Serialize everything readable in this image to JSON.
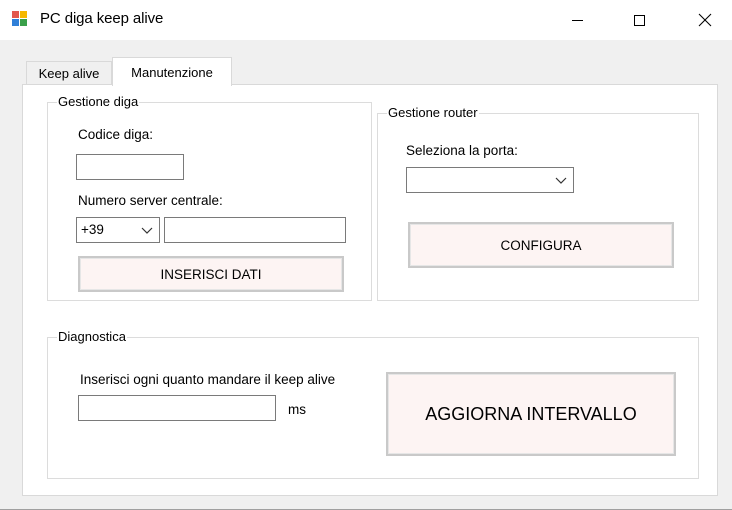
{
  "window": {
    "title": "PC diga keep alive",
    "icon": "app-window-icon",
    "controls": {
      "minimize": "minimize-icon",
      "maximize": "maximize-icon",
      "close": "close-icon"
    }
  },
  "tabs": [
    {
      "label": "Keep alive",
      "active": false
    },
    {
      "label": "Manutenzione",
      "active": true
    }
  ],
  "gestione_diga": {
    "title": "Gestione diga",
    "codice_label": "Codice diga:",
    "codice_value": "",
    "numero_label": "Numero server centrale:",
    "prefix_value": "+39",
    "numero_value": "",
    "inserisci_button": "INSERISCI DATI"
  },
  "gestione_router": {
    "title": "Gestione router",
    "porta_label": "Seleziona la porta:",
    "porta_value": "",
    "configura_button": "CONFIGURA"
  },
  "diagnostica": {
    "title": "Diagnostica",
    "intervallo_label": "Inserisci ogni quanto mandare il keep alive",
    "intervallo_value": "",
    "unit": "ms",
    "aggiorna_button": "AGGIORNA INTERVALLO"
  },
  "colors": {
    "button_bg": "#fdf4f3",
    "border": "#dcdcdc",
    "titlebar": "#ffffff",
    "window_bg": "#f0f0f0"
  }
}
